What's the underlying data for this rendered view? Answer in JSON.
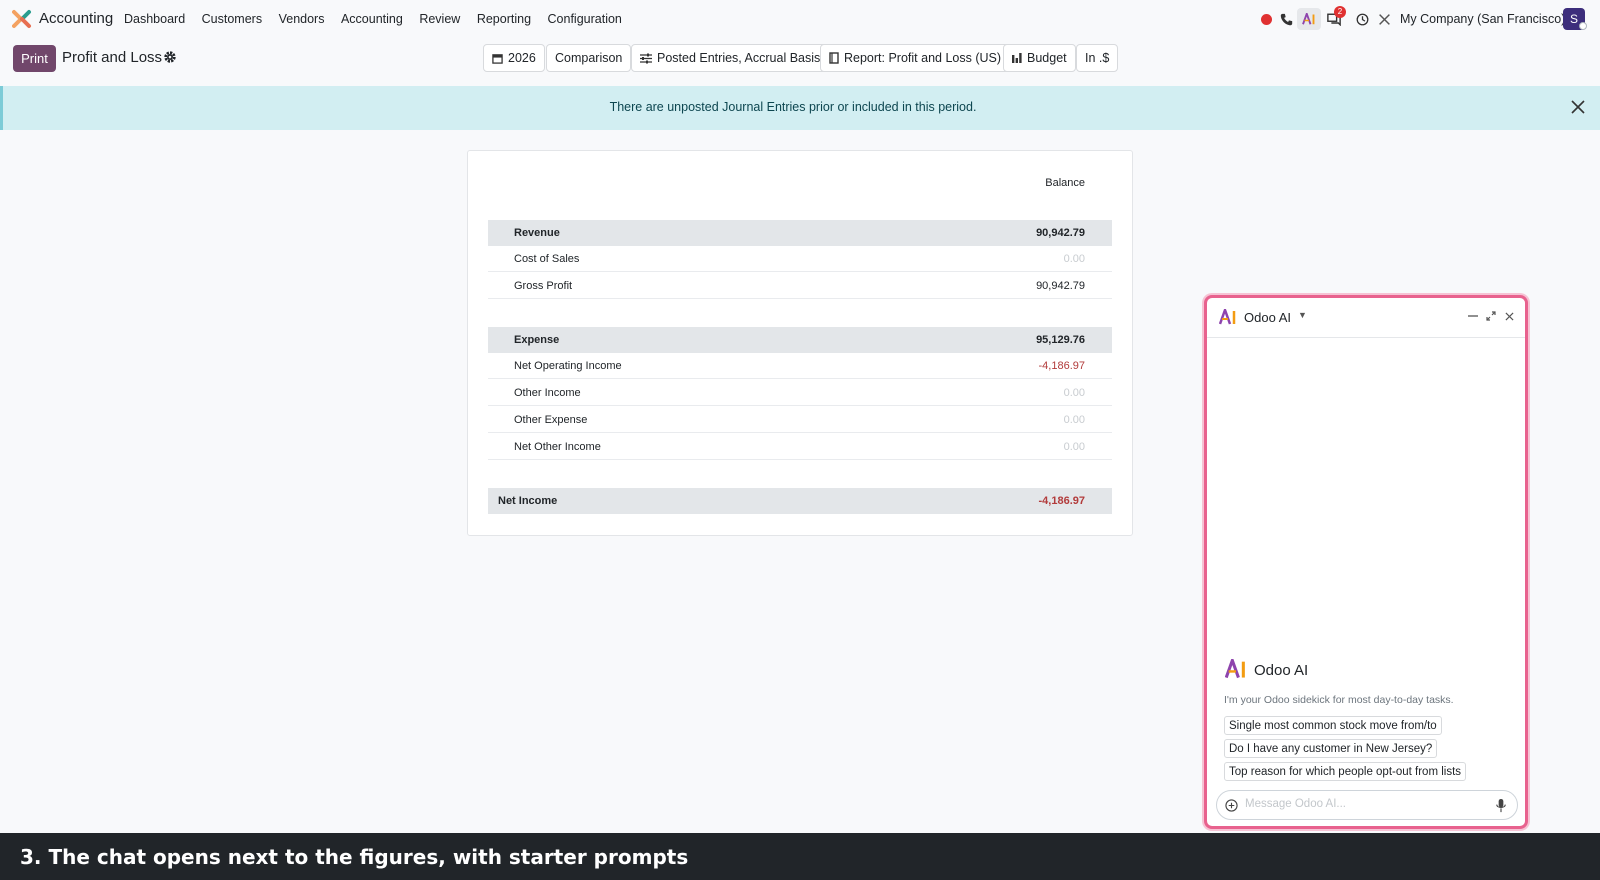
{
  "nav": {
    "app_name": "Accounting",
    "menu": [
      "Dashboard",
      "Customers",
      "Vendors",
      "Accounting",
      "Review",
      "Reporting",
      "Configuration"
    ],
    "chat_badge": "2",
    "company": "My Company (San Francisco)",
    "avatar_letter": "S"
  },
  "control": {
    "print_label": "Print",
    "title": "Profit and Loss",
    "filters": {
      "year": "2026",
      "comparison": "Comparison",
      "entries": "Posted Entries, Accrual Basis",
      "report": "Report: Profit and Loss (US)",
      "budget": "Budget",
      "currency": "In .$"
    }
  },
  "alert": {
    "text": "There are unposted Journal Entries prior or included in this period."
  },
  "report": {
    "column_header": "Balance",
    "rows": [
      {
        "label": "Revenue",
        "value": "90,942.79"
      },
      {
        "label": "Cost of Sales",
        "value": "0.00"
      },
      {
        "label": "Gross Profit",
        "value": "90,942.79"
      },
      {
        "label": "Expense",
        "value": "95,129.76"
      },
      {
        "label": "Net Operating Income",
        "value": "-4,186.97"
      },
      {
        "label": "Other Income",
        "value": "0.00"
      },
      {
        "label": "Other Expense",
        "value": "0.00"
      },
      {
        "label": "Net Other Income",
        "value": "0.00"
      },
      {
        "label": "Net Income",
        "value": "-4,186.97"
      }
    ]
  },
  "chat": {
    "header_name": "Odoo AI",
    "welcome_title": "Odoo AI",
    "welcome_sub": "I'm your Odoo sidekick for most day-to-day tasks.",
    "prompts": [
      "Single most common stock move from/to",
      "Do I have any customer in New Jersey?",
      "Top reason for which people opt-out from lists"
    ],
    "input_placeholder": "Message Odoo AI..."
  },
  "caption": {
    "text": "3. The chat opens next to the figures, with starter prompts"
  },
  "colors": {
    "primary": "#71476b",
    "alert_bg": "#d2eef2",
    "negative": "#b23b3b",
    "chat_highlight": "#e8628e"
  }
}
